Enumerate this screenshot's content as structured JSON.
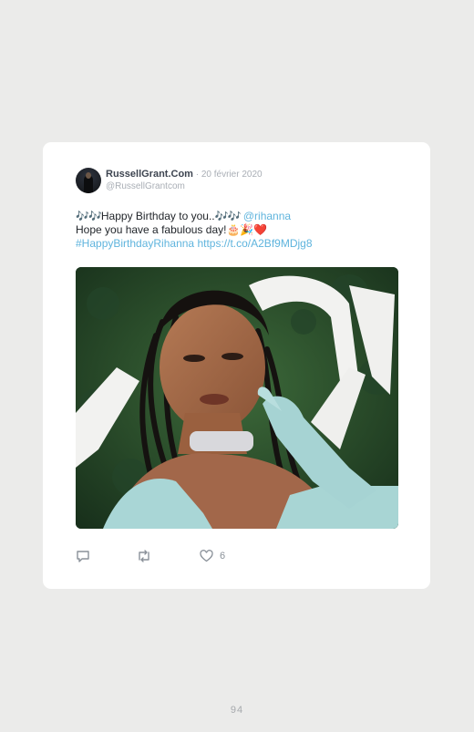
{
  "tweet": {
    "author_name": "RussellGrant.Com",
    "date": " · 20 février 2020",
    "handle": "@RussellGrantcom",
    "line1_emoji": "🎶🎶",
    "line1_text": "Happy Birthday to you..",
    "line1_emoji2": "🎶🎶",
    "mention": "@rihanna",
    "line2_text": "Hope you have a fabulous day!",
    "line2_emoji": "🎂🎉❤️",
    "hashtag": "#HappyBirthdayRihanna",
    "link": "https://t.co/A2Bf9MDjg8",
    "image_alt": "Woman with long braids wearing a crystal choker and pale blue gloves in front of a green hedge"
  },
  "actions": {
    "reply_icon": "reply-icon",
    "retweet_icon": "retweet-icon",
    "like_icon": "heart-icon",
    "like_count": "6"
  },
  "page_number": "94",
  "colors": {
    "link": "#5fb4dd",
    "background": "#ebebea",
    "card": "#ffffff"
  }
}
